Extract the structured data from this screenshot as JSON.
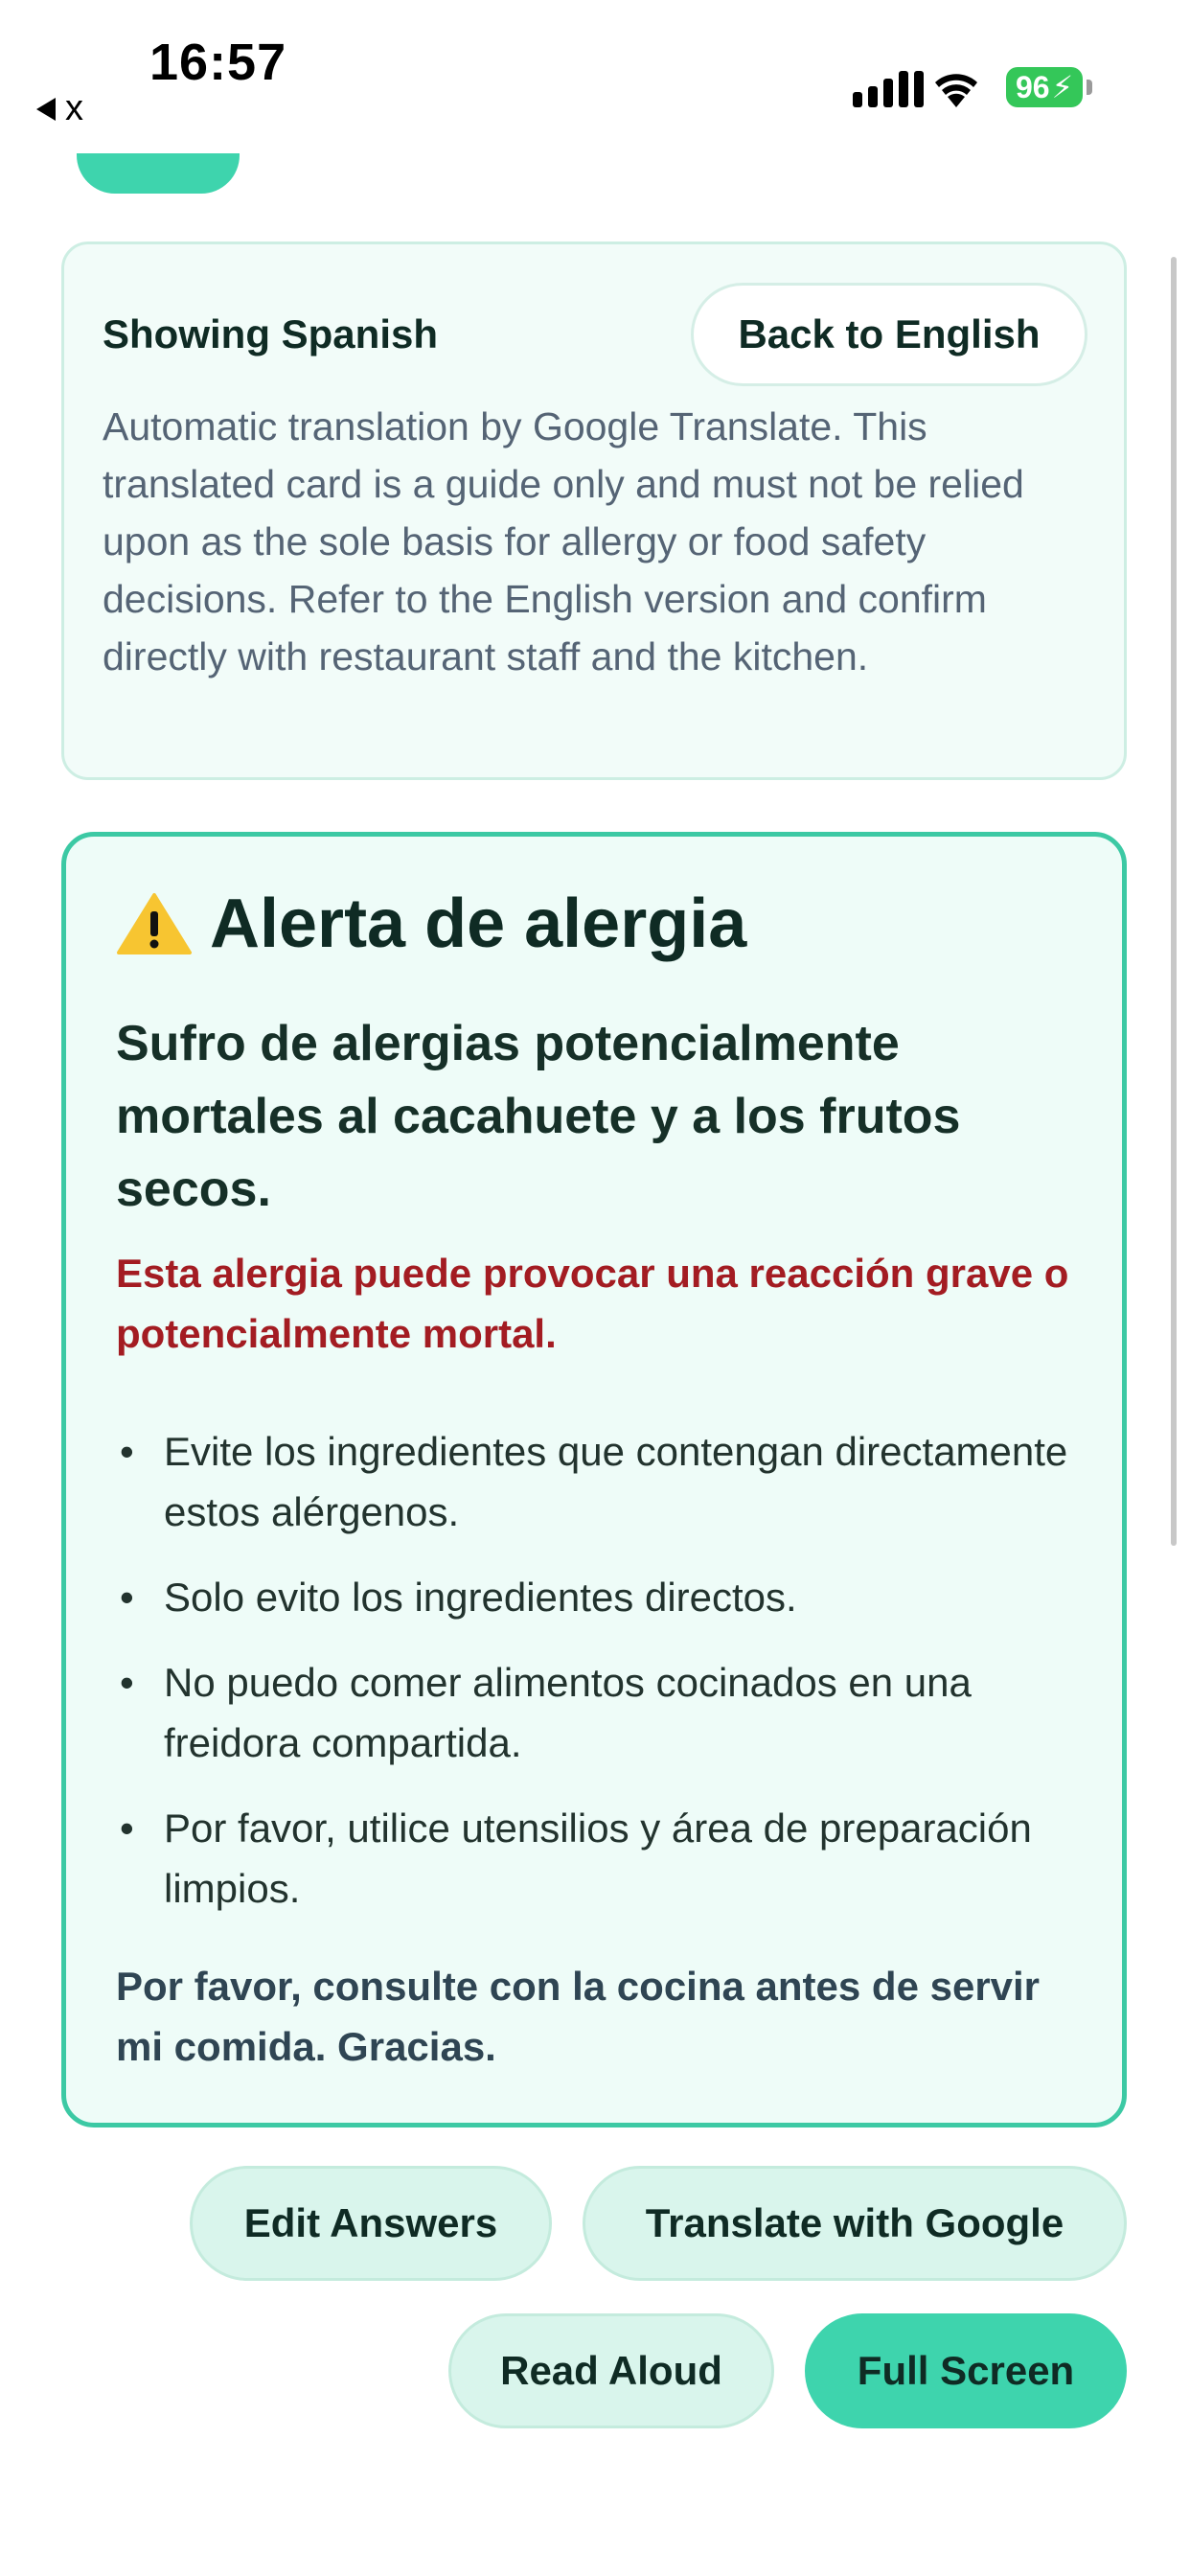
{
  "status_bar": {
    "time": "16:57",
    "back_app_label": "x",
    "battery": "96"
  },
  "notice": {
    "title": "Showing Spanish",
    "back_button": "Back to English",
    "body": "Automatic translation by Google Translate. This translated card is a guide only and must not be relied upon as the sole basis for allergy or food safety decisions. Refer to the English version and confirm directly with restaurant staff and the kitchen."
  },
  "alert": {
    "title": "Alerta de alergia",
    "subtitle": "Sufro de alergias potencialmente mortales al cacahuete y a los frutos secos.",
    "warning": "Esta alergia puede provocar una reacción grave o potencialmente mortal.",
    "items": [
      "Evite los ingredientes que contengan directamente estos alérgenos.",
      "Solo evito los ingredientes directos.",
      "No puedo comer alimentos cocinados en una freidora compartida.",
      "Por favor, utilice utensilios y área de preparación limpios."
    ],
    "footer": "Por favor, consulte con la cocina antes de servir mi comida. Gracias."
  },
  "actions": {
    "edit_answers": "Edit Answers",
    "translate": "Translate with Google",
    "read_aloud": "Read Aloud",
    "full_screen": "Full Screen"
  },
  "colors": {
    "accent": "#3ed4ad",
    "card_border": "#3cc9a4",
    "danger_text": "#a31c22",
    "battery": "#34c759"
  }
}
